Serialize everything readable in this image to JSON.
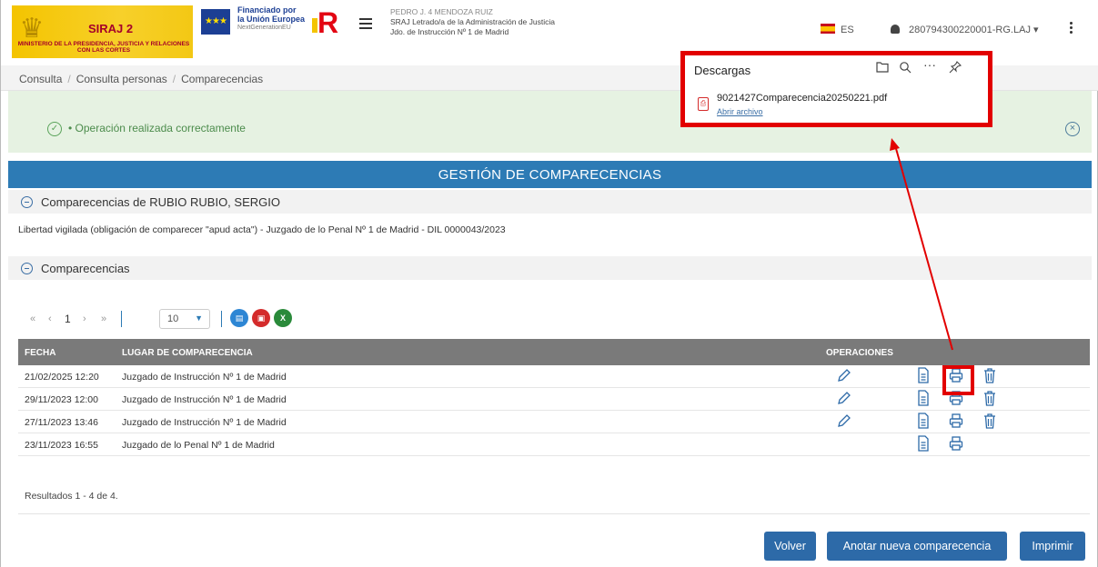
{
  "header": {
    "siraj_name": "SIRAJ 2",
    "ministry": "MINISTERIO DE LA PRESIDENCIA, JUSTICIA Y RELACIONES CON LAS CORTES",
    "eu_line1": "Financiado por",
    "eu_line2": "la Unión Europea",
    "eu_line3": "NextGenerationEU",
    "user_name": "PEDRO J. 4 MENDOZA RUIZ",
    "user_role": "SRAJ Letrado/a de la Administración de Justicia",
    "user_court": "Jdo. de Instrucción Nº 1 de Madrid",
    "language": "ES",
    "user_code": "280794300220001-RG.LAJ"
  },
  "breadcrumb": [
    "Consulta",
    "Consulta personas",
    "Comparecencias"
  ],
  "alert": {
    "message": "Operación realizada correctamente"
  },
  "downloads": {
    "title": "Descargas",
    "file_name": "9021427Comparecencia20250221.pdf",
    "open_label": "Abrir archivo",
    "tools": [
      "folder-icon",
      "search-icon",
      "more-icon",
      "pin-icon"
    ]
  },
  "main": {
    "title": "GESTIÓN DE COMPARECENCIAS",
    "section_person": "Comparecencias de RUBIO RUBIO, SERGIO",
    "description": "Libertad vigilada (obligación de comparecer \"apud acta\") - Juzgado de lo Penal Nº 1 de Madrid - DIL 0000043/2023",
    "section_list": "Comparecencias"
  },
  "pager": {
    "first": "«",
    "prev": "‹",
    "current": "1",
    "next": "›",
    "last": "»",
    "page_size": "10",
    "export": [
      "doc-export-icon",
      "pdf-export-icon",
      "excel-export-icon"
    ]
  },
  "table": {
    "headers": {
      "fecha": "FECHA",
      "lugar": "LUGAR DE COMPARECENCIA",
      "operaciones": "OPERACIONES"
    },
    "rows": [
      {
        "fecha": "21/02/2025 12:20",
        "lugar": "Juzgado de Instrucción Nº 1 de Madrid",
        "edit": true,
        "delete": true
      },
      {
        "fecha": "29/11/2023 12:00",
        "lugar": "Juzgado de Instrucción Nº 1 de Madrid",
        "edit": true,
        "delete": true
      },
      {
        "fecha": "27/11/2023 13:46",
        "lugar": "Juzgado de Instrucción Nº 1 de Madrid",
        "edit": true,
        "delete": true
      },
      {
        "fecha": "23/11/2023 16:55",
        "lugar": "Juzgado de lo Penal Nº 1 de Madrid",
        "edit": false,
        "delete": false
      }
    ],
    "results": "Resultados 1 - 4 de 4."
  },
  "buttons": {
    "back": "Volver",
    "new": "Anotar nueva comparecencia",
    "print": "Imprimir"
  },
  "colors": {
    "primary": "#2d7bb5",
    "button": "#2d6aa8",
    "success_bg": "#e6f2e2",
    "highlight": "#e20000"
  }
}
